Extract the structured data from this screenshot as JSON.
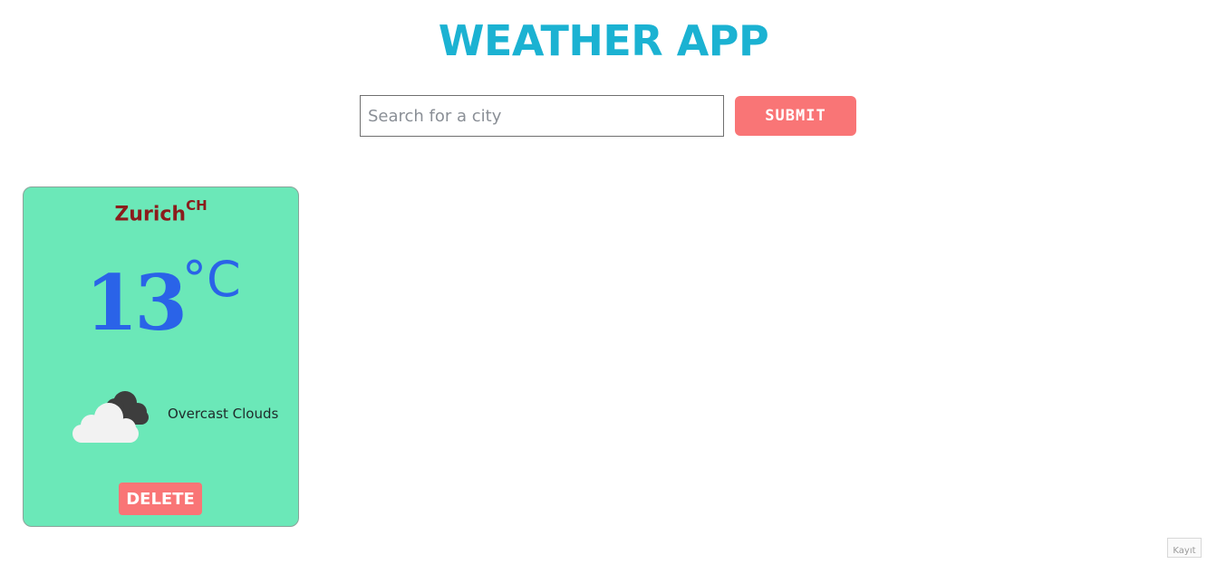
{
  "header": {
    "title": "WEATHER APP"
  },
  "search": {
    "placeholder": "Search for a city",
    "value": "",
    "submit_label": "SUBMIT"
  },
  "cards": [
    {
      "city": "Zurich",
      "country": "CH",
      "temperature": "13",
      "unit": "°C",
      "icon": "overcast-clouds-icon",
      "description": "Overcast Clouds",
      "delete_label": "DELETE"
    }
  ],
  "colors": {
    "title": "#1bb2d2",
    "button": "#f97576",
    "card": "#6be8b8",
    "city": "#8b1c1c",
    "temperature": "#2a63e8"
  },
  "corner_badge": {
    "label": "Kayıt"
  }
}
